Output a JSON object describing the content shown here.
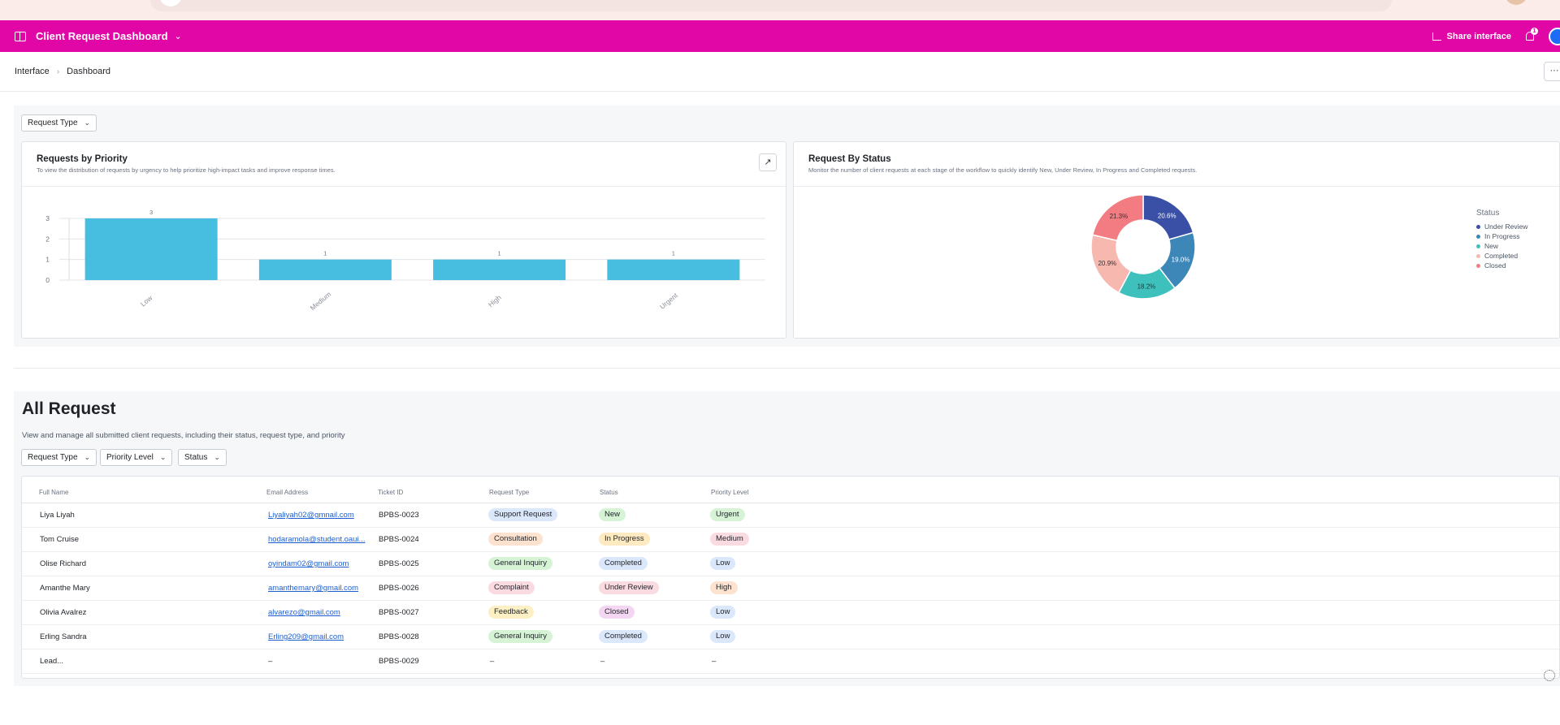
{
  "app": {
    "title": "Client Request Dashboard",
    "accent_color": "#e007a6",
    "share_label": "Share interface",
    "notification_count": "1"
  },
  "breadcrumb": {
    "items": [
      "Interface",
      "Dashboard"
    ],
    "more_label": "···"
  },
  "section1": {
    "filter_label": "Request Type",
    "priority_card": {
      "title": "Requests by Priority",
      "subtitle": "To view the distribution of requests by urgency to help prioritize high-impact tasks and improve response times."
    },
    "status_card": {
      "title": "Request By Status",
      "subtitle": "Monitor the number of client requests at each stage of the workflow to quickly identify New, Under Review, In Progress and Completed requests."
    }
  },
  "chart_data": [
    {
      "type": "bar",
      "title": "Requests by Priority",
      "categories": [
        "Low",
        "Medium",
        "High",
        "Urgent"
      ],
      "values": [
        3,
        1,
        1,
        1
      ],
      "ylim": [
        0,
        3
      ],
      "yticks": [
        0,
        1,
        2,
        3
      ],
      "bar_color": "#47bedf",
      "grid": true
    },
    {
      "type": "pie",
      "donut": true,
      "title": "Request By Status",
      "legend_title": "Status",
      "legend_position": "right",
      "slices": [
        {
          "name": "Under Review",
          "value": 20.6,
          "label": "20.6%",
          "color": "#3a4fa6"
        },
        {
          "name": "In Progress",
          "value": 19.0,
          "label": "19.0%",
          "color": "#3d86b8"
        },
        {
          "name": "New",
          "value": 18.2,
          "label": "18.2%",
          "color": "#3ec1bd"
        },
        {
          "name": "Completed",
          "value": 20.9,
          "label": "20.9%",
          "color": "#f7b8b0"
        },
        {
          "name": "Closed",
          "value": 21.3,
          "label": "21.3%",
          "color": "#f37c82"
        }
      ]
    }
  ],
  "section2": {
    "title": "All Request",
    "subtitle": "View and manage all submitted client requests, including their status, request type, and priority",
    "filters": [
      "Request Type",
      "Priority Level",
      "Status"
    ],
    "columns": [
      "Full Name",
      "Email Address",
      "Ticket ID",
      "Request Type",
      "Status",
      "Priority Level"
    ],
    "rows": [
      {
        "name": "Liya Liyah",
        "email": "Liyaliyah02@gmnail.com",
        "ticket": "BPBS-0023",
        "type": "Support Request",
        "status": "New",
        "priority": "Urgent"
      },
      {
        "name": "Tom Cruise",
        "email": "hodaramola@student.oaui...",
        "ticket": "BPBS-0024",
        "type": "Consultation",
        "status": "In Progress",
        "priority": "Medium"
      },
      {
        "name": "Olise Richard",
        "email": "oyindam02@gmail.com",
        "ticket": "BPBS-0025",
        "type": "General Inquiry",
        "status": "Completed",
        "priority": "Low"
      },
      {
        "name": "Amanthe Mary",
        "email": "amanthemary@gmail.com",
        "ticket": "BPBS-0026",
        "type": "Complaint",
        "status": "Under Review",
        "priority": "High"
      },
      {
        "name": "Olivia Avalrez",
        "email": "alvarezo@gmail.com",
        "ticket": "BPBS-0027",
        "type": "Feedback",
        "status": "Closed",
        "priority": "Low"
      },
      {
        "name": "Erling Sandra",
        "email": "Erling209@gmail.com",
        "ticket": "BPBS-0028",
        "type": "General Inquiry",
        "status": "Completed",
        "priority": "Low"
      },
      {
        "name": "Lead...",
        "email": "–",
        "ticket": "BPBS-0029",
        "type": "–",
        "status": "–",
        "priority": "–"
      }
    ],
    "pill_colors": {
      "Support Request": "#dbe7fb",
      "Consultation": "#fde3cf",
      "General Inquiry": "#d6f3d6",
      "Complaint": "#fbdbe2",
      "Feedback": "#fdf0c4",
      "New": "#d6f3d6",
      "In Progress": "#fdeac0",
      "Completed": "#dbe7fb",
      "Under Review": "#fbdbe2",
      "Closed": "#f5d6f2",
      "Urgent": "#d6f3d6",
      "Medium": "#fbdbe2",
      "Low": "#dbe7fb",
      "High": "#fde3cf"
    }
  }
}
